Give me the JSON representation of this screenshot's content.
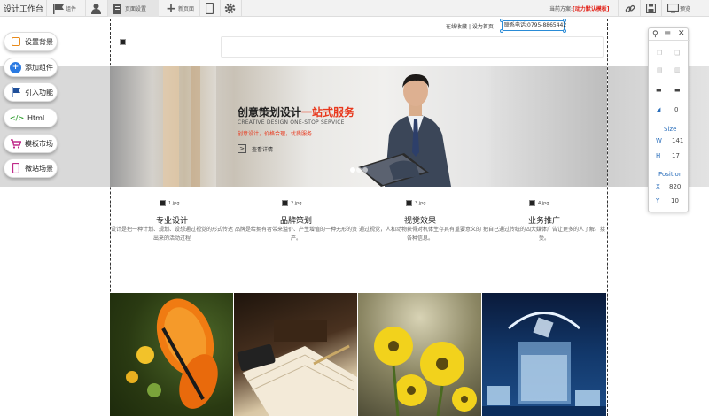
{
  "toolbar": {
    "title": "设计工作台",
    "component_label": "组件",
    "page_settings_label": "页面设置",
    "new_page_label": "新页面",
    "plan_prefix": "当前方案:",
    "plan_name": "[动力默认模板]",
    "preview_label": "预览"
  },
  "sidebar": {
    "items": [
      {
        "label": "设置背景",
        "icon": "square-icon"
      },
      {
        "label": "添加组件",
        "icon": "plus-circle-icon"
      },
      {
        "label": "引入功能",
        "icon": "flag-icon"
      },
      {
        "label": "Html",
        "icon": "code-icon"
      },
      {
        "label": "模板市场",
        "icon": "cart-icon"
      },
      {
        "label": "微站场景",
        "icon": "mobile-icon"
      }
    ]
  },
  "site": {
    "fav_link": "在线收藏",
    "sep": "|",
    "home_link": "设为首页",
    "phone": "联系电话:0795-8865442"
  },
  "banner": {
    "title_part1": "创意策划设计",
    "title_part2": "一站式服务",
    "subtitle": "CREATIVE DESIGN ONE-STOP SERVICE",
    "tagline": "创意设计，价格合理，优质服务",
    "more": "查看详情"
  },
  "features": [
    {
      "img": "1.jpg",
      "title": "专业设计",
      "desc": "设计是把一种计划、规划、设想通过视觉的形式传达出来的活动过程"
    },
    {
      "img": "2.jpg",
      "title": "品牌策划",
      "desc": "品牌是给拥有者带来溢价、产生增值的一种无形的资产。"
    },
    {
      "img": "3.jpg",
      "title": "视觉效果",
      "desc": "通过视觉，人和动物获得对机体生存具有重要意义的各种信息。"
    },
    {
      "img": "4.jpg",
      "title": "业务推广",
      "desc": "把自己通过传统的四大媒体广告让更多的人了解、接受。"
    }
  ],
  "photos": [
    "butterfly",
    "notebook",
    "yellow-flowers",
    "ice-water-glass"
  ],
  "panel": {
    "rotation": "0",
    "size_label": "Size",
    "w_label": "W",
    "w": "141",
    "h_label": "H",
    "h": "17",
    "position_label": "Position",
    "x_label": "X",
    "x": "820",
    "y_label": "Y",
    "y": "10"
  },
  "colors": {
    "accent": "#e8381d",
    "panel_blue": "#2a6ebb",
    "plan_red": "#e2231a"
  }
}
